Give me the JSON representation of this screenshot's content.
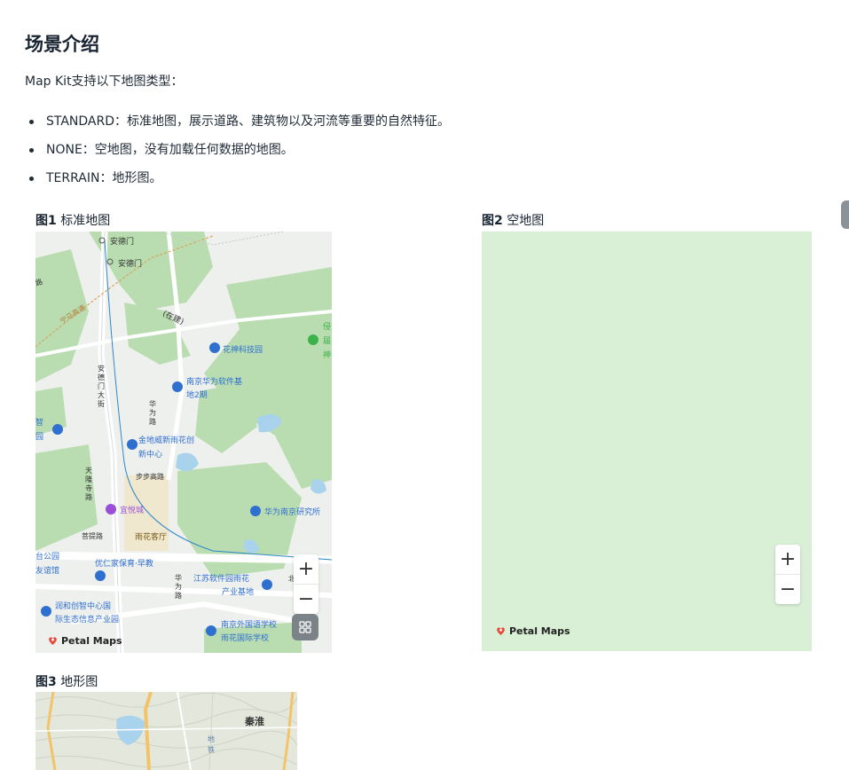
{
  "heading": "场景介绍",
  "intro": "Map Kit支持以下地图类型：",
  "types": [
    "STANDARD：标准地图，展示道路、建筑物以及河流等重要的自然特征。",
    "NONE：空地图，没有加载任何数据的地图。",
    "TERRAIN：地形图。"
  ],
  "figures": [
    {
      "label": "图1",
      "caption": "标准地图"
    },
    {
      "label": "图2",
      "caption": "空地图"
    },
    {
      "label": "图3",
      "caption": "地形图"
    }
  ],
  "map1": {
    "labels": {
      "andemen1": "安德门",
      "andemen2": "安德门",
      "zuoxian": "(在建)",
      "huashen_park": "花神科技园",
      "huawei_base_1": "南京华为软件基",
      "huawei_base_2": "地2期",
      "jindi_1": "金地威新雨花创",
      "jindi_2": "新中心",
      "bubu": "步步高路",
      "tianlong_1": "天",
      "tianlong_2": "隆",
      "tianlong_3": "寺",
      "tianlong_4": "路",
      "yiyuecheng": "宜悦城",
      "huawei_inst": "华为南京研究所",
      "putilu": "菩提路",
      "yuhuakt": "雨花客厅",
      "youren": "优仁家保育·早教",
      "jiangsu_1": "江苏软件园雨花",
      "jiangsu_2": "产业基地",
      "taipark_1": "台公园",
      "taipark_2": "友谊馆",
      "runhe_1": "润和创智中心国",
      "runhe_2": "际生态信息产业园",
      "nanjing_school_1": "南京外国语学校",
      "nanjing_school_2": "雨花国际学校",
      "andemen_ave": "安德门大街",
      "huawei_road": "华为路",
      "huawei_road2": "华为路",
      "zhi_1": "智",
      "zhi_2": "园",
      "right_1": "侵",
      "right_2": "届",
      "right_3": "神",
      "left_road": "路",
      "diag_road": "宁马高速",
      "top_road": "北"
    },
    "zoom_in": "+",
    "zoom_out": "−",
    "brand": "Petal Maps"
  },
  "map2": {
    "zoom_in": "+",
    "zoom_out": "−",
    "brand": "Petal Maps"
  },
  "map3": {
    "labels": {
      "qinhuai": "秦淮",
      "road_a": "地",
      "road_b": "铁"
    }
  },
  "colors": {
    "park_green": "#b9ddb0",
    "water": "#a9d3ec",
    "poi_blue": "#2f6fd0",
    "poi_purple": "#9a4fd8",
    "empty_map": "#d9f0d6",
    "brand_red": "#e64a3b"
  }
}
